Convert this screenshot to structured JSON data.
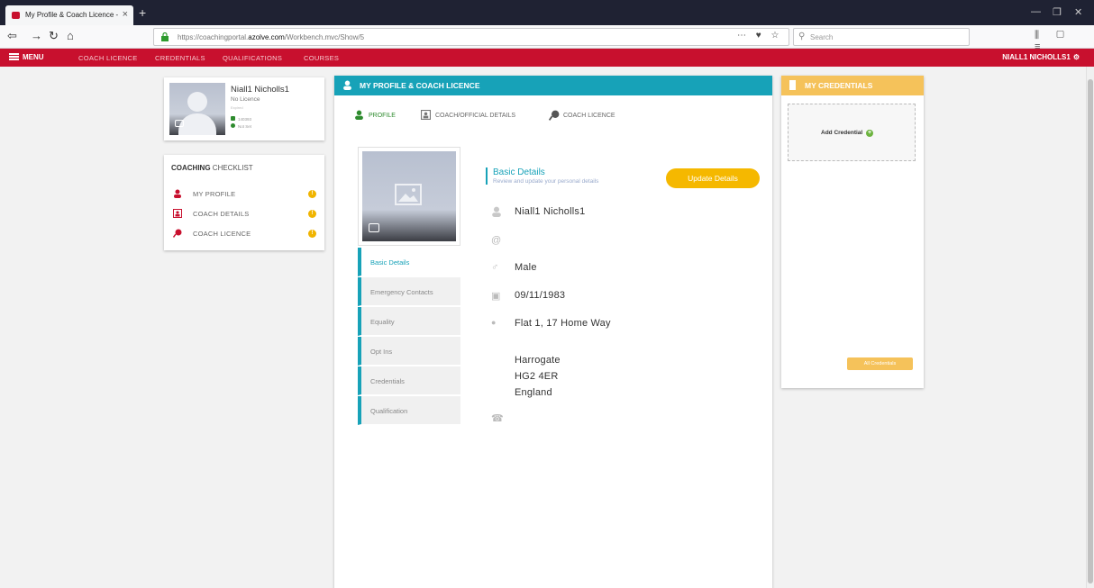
{
  "browser": {
    "tab_title": "My Profile & Coach Licence - ",
    "url_prefix": "https://coachingportal.",
    "url_domain": "azolve.com",
    "url_suffix": "/Workbench.mvc/Show/5",
    "search_placeholder": "Search",
    "url_icons": "⋯ ♥ ☆",
    "tool_icons": "≡"
  },
  "appbar": {
    "menu_label": "MENU",
    "nav": [
      "COACH LICENCE",
      "CREDENTIALS",
      "QUALIFICATIONS",
      "COURSES"
    ],
    "user_name": "NIALL1 NICHOLLS1",
    "colors": {
      "brand": "#c8102e",
      "teal": "#17a2b8",
      "gold": "#f5c25a",
      "amber": "#f5b800"
    }
  },
  "profile_card": {
    "name": "Niall1 Nicholls1",
    "licence": "No Licence",
    "sub": "Expired",
    "member_id": "140393",
    "status": "Not Set"
  },
  "checklist": {
    "title_bold": "COACHING",
    "title_rest": " CHECKLIST",
    "items": [
      {
        "label": "MY PROFILE",
        "icon": "user-icon"
      },
      {
        "label": "COACH DETAILS",
        "icon": "id-card-icon"
      },
      {
        "label": "COACH LICENCE",
        "icon": "whistle-icon"
      }
    ],
    "warn_glyph": "!"
  },
  "main": {
    "header": "MY PROFILE & COACH LICENCE",
    "subtabs": [
      "PROFILE",
      "COACH/OFFICIAL DETAILS",
      "COACH LICENCE"
    ],
    "vtabs": [
      "Basic Details",
      "Emergency Contacts",
      "Equality",
      "Opt Ins",
      "Credentials",
      "Qualification"
    ],
    "section_title": "Basic Details",
    "section_subtitle": "Review and update your personal details",
    "update_button": "Update Details",
    "fields": {
      "name": "Niall1 Nicholls1",
      "email": "",
      "gender": "Male",
      "dob": "09/11/1983",
      "address1": "Flat 1, 17 Home Way",
      "town": "Harrogate",
      "postcode": "HG2 4ER",
      "country": "England",
      "phone": ""
    },
    "icons": {
      "name": "♂",
      "email": "@",
      "gender": "♂",
      "dob": "▣",
      "address": "●",
      "phone": "☎"
    }
  },
  "credentials": {
    "header": "MY CREDENTIALS",
    "add_label": "Add Credential",
    "add_plus": "+",
    "all_label": "All Credentials"
  }
}
